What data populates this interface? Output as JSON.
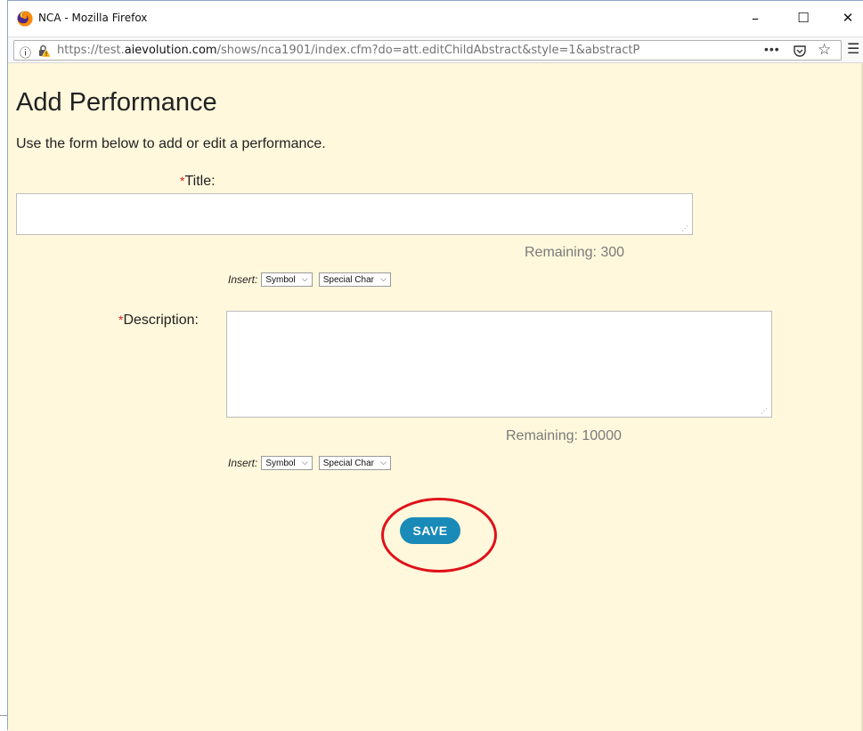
{
  "window": {
    "title": "NCA - Mozilla Firefox",
    "minimize": "–",
    "maximize": "☐",
    "close": "✕"
  },
  "urlbar": {
    "prefix": "https://test.",
    "domain": "aievolution.com",
    "path": "/shows/nca1901/index.cfm?do=att.editChildAbstract&style=1&abstractP",
    "more_icon": "•••",
    "star_icon": "☆",
    "menu_icon": "☰",
    "info_icon": "ⓘ"
  },
  "page": {
    "title": "Add Performance",
    "intro": "Use the form below to add or edit a performance.",
    "required_mark": "*",
    "title_field": {
      "label": "Title:",
      "value": "",
      "remaining": "Remaining: 300"
    },
    "description_field": {
      "label": "Description:",
      "value": "",
      "remaining": "Remaining: 10000"
    },
    "insert": {
      "label": "Insert:",
      "symbol_selected": "Symbol",
      "special_selected": "Special Char"
    },
    "save_label": "SAVE"
  },
  "colors": {
    "page_background": "#fff8dc",
    "save_button": "#1a8ab8",
    "required": "#dd2222",
    "annotation": "#e0111a"
  }
}
